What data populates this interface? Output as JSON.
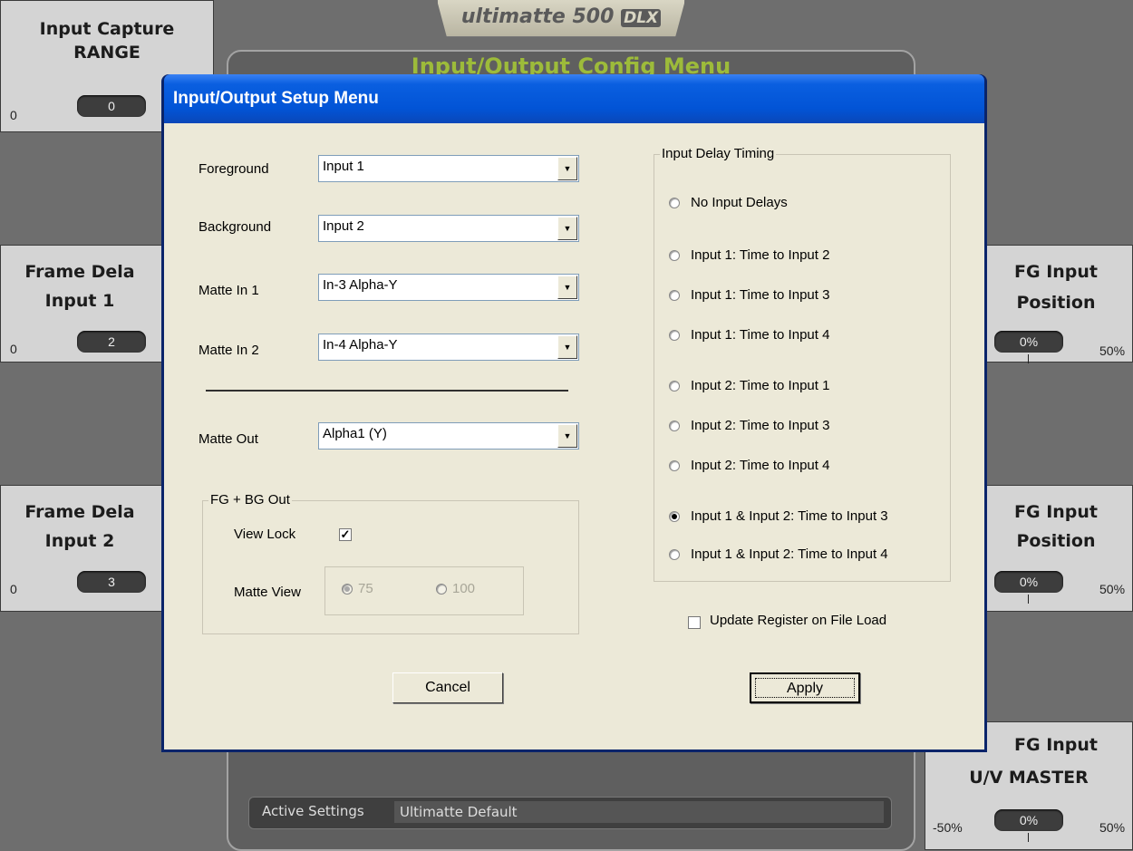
{
  "background": {
    "brand": "ultimatte 500",
    "brand_badge": "DLX",
    "config_title": "Input/Output Config Menu",
    "panels": {
      "input_capture": {
        "title1": "Input Capture",
        "title2": "RANGE",
        "min": "0",
        "value": "0"
      },
      "frame_delay_1": {
        "title1": "Frame Dela",
        "title2": "Input 1",
        "min": "0",
        "value": "2"
      },
      "frame_delay_2": {
        "title1": "Frame Dela",
        "title2": "Input 2",
        "min": "0",
        "value": "3"
      },
      "fg_pos_1": {
        "title1": "FG Input",
        "title2": "Position",
        "value": "0%",
        "max": "50%"
      },
      "fg_pos_2": {
        "title1": "FG Input",
        "title2": "Position",
        "value": "0%",
        "max": "50%"
      },
      "fg_uv": {
        "title1": "FG Input",
        "title2": "U/V MASTER",
        "min": "-50%",
        "value": "0%",
        "max": "50%"
      }
    },
    "active_settings": {
      "label": "Active Settings",
      "value": "Ultimatte Default"
    }
  },
  "dialog": {
    "title": "Input/Output Setup Menu",
    "fields": {
      "foreground": {
        "label": "Foreground",
        "value": "Input 1"
      },
      "background": {
        "label": "Background",
        "value": "Input 2"
      },
      "matte_in_1": {
        "label": "Matte In 1",
        "value": "In-3 Alpha-Y"
      },
      "matte_in_2": {
        "label": "Matte In 2",
        "value": "In-4 Alpha-Y"
      },
      "matte_out": {
        "label": "Matte Out",
        "value": "Alpha1 (Y)"
      }
    },
    "fgbg": {
      "legend": "FG + BG Out",
      "view_lock_label": "View Lock",
      "view_lock_checked": true,
      "matte_view_label": "Matte View",
      "opt_75": "75",
      "opt_100": "100",
      "selected": "75"
    },
    "timing": {
      "legend": "Input Delay Timing",
      "options": [
        "No Input Delays",
        "Input 1: Time to Input 2",
        "Input 1: Time to Input 3",
        "Input 1: Time to Input 4",
        "Input 2: Time to Input 1",
        "Input 2: Time to Input 3",
        "Input 2: Time to Input 4",
        "Input 1 & Input 2: Time to Input 3",
        "Input 1 & Input 2: Time to Input 4"
      ],
      "selected_index": 7
    },
    "update_register_label": "Update Register on File Load",
    "update_register_checked": false,
    "cancel_label": "Cancel",
    "apply_label": "Apply"
  }
}
